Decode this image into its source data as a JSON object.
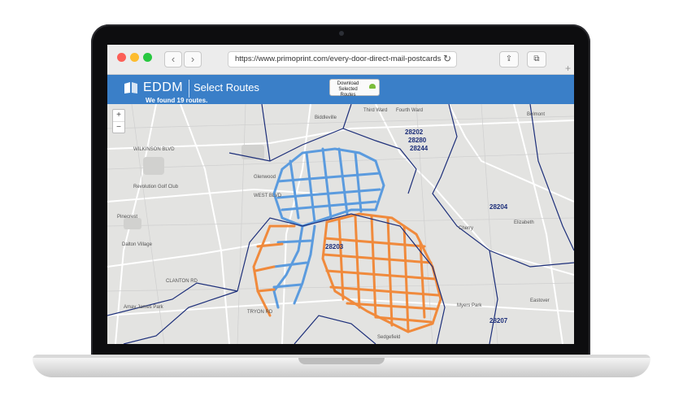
{
  "browser": {
    "url": "https://www.primoprint.com/every-door-direct-mail-postcards",
    "back_icon": "chevron-left-icon",
    "forward_icon": "chevron-right-icon",
    "reload_icon": "reload-icon",
    "share_icon": "share-icon",
    "tabs_icon": "tabs-icon"
  },
  "header": {
    "logo": "EDDM",
    "title": "Select Routes",
    "found": "We found 19 routes.",
    "download_label": "Download Selected Routes",
    "color": "#3a7fc8"
  },
  "map": {
    "zoom_in": "+",
    "zoom_out": "−",
    "route_colors": {
      "selected_blue": "#5b9bde",
      "selected_orange": "#f08a3c",
      "boundary": "#1d2f7a"
    },
    "zip_labels": [
      "28202",
      "28280",
      "28244",
      "28204",
      "28203",
      "28207"
    ],
    "labels": [
      "Third Ward",
      "Fourth Ward",
      "Biddleville",
      "Belmont",
      "WILKINSON BLVD",
      "Glenwood",
      "Pinecrest",
      "Dalton Village",
      "WEST BLVD",
      "Cherry",
      "Elizabeth",
      "Myers Park",
      "Eastover",
      "Sedgefield",
      "Amay James Park",
      "Revolution Golf Club",
      "CLANTON RD",
      "TRYON RD"
    ]
  }
}
